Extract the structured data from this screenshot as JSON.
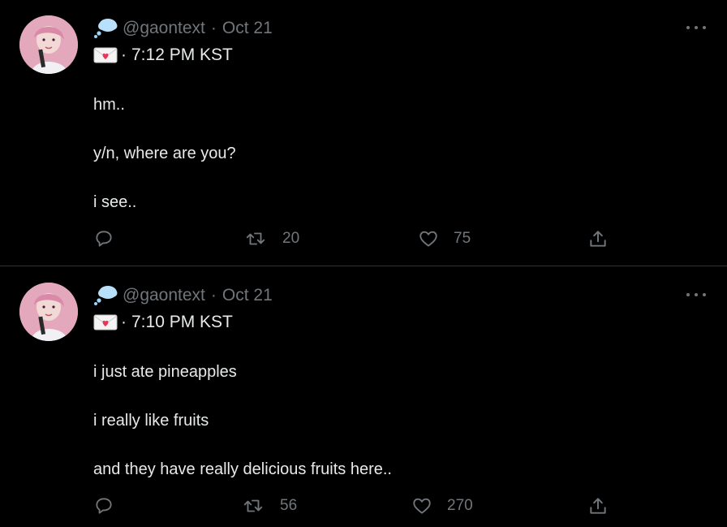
{
  "tweets": [
    {
      "handle": "@gaontext",
      "separator": "·",
      "date": "Oct 21",
      "time_sep": "·",
      "time": "7:12 PM KST",
      "lines": [
        "hm..",
        "y/n, where are you?",
        "i see.."
      ],
      "retweets": "20",
      "likes": "75"
    },
    {
      "handle": "@gaontext",
      "separator": "·",
      "date": "Oct 21",
      "time_sep": "·",
      "time": "7:10 PM KST",
      "lines": [
        "i just ate pineapples",
        "i really like fruits",
        "and they have really delicious fruits here.."
      ],
      "retweets": "56",
      "likes": "270"
    }
  ],
  "icons": {
    "cloud": "thought-balloon-icon",
    "envelope": "love-letter-icon",
    "reply": "reply-icon",
    "retweet": "retweet-icon",
    "like": "heart-icon",
    "share": "share-icon",
    "more": "more-icon"
  },
  "colors": {
    "background": "#000000",
    "text": "#e7e9ea",
    "muted": "#71767b",
    "divider": "#2f3336"
  }
}
